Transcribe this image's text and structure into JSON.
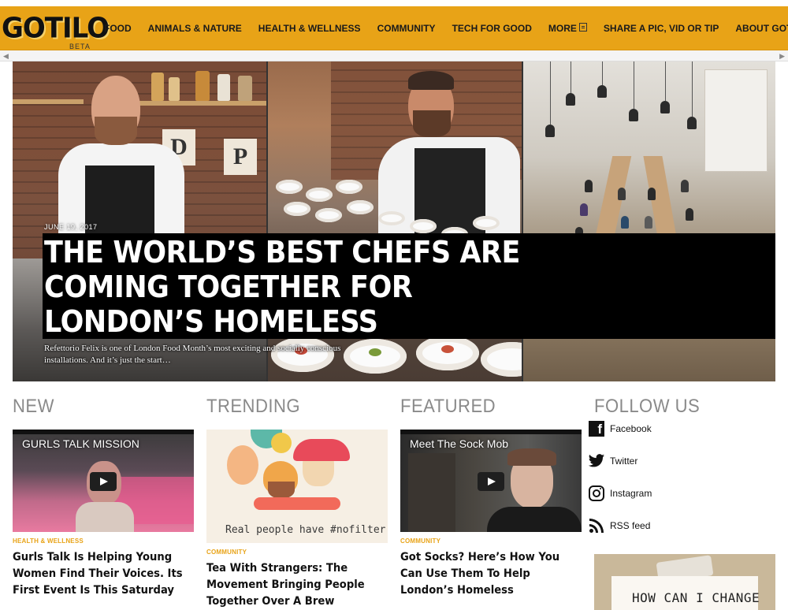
{
  "nav": {
    "logo": "GOTILO",
    "logo_beta": "BETA",
    "items": [
      {
        "label": "FOOD"
      },
      {
        "label": "ANIMALS & NATURE"
      },
      {
        "label": "HEALTH & WELLNESS"
      },
      {
        "label": "COMMUNITY"
      },
      {
        "label": "TECH FOR GOOD"
      },
      {
        "label": "MORE"
      },
      {
        "label": "SHARE A PIC, VID OR TIP"
      },
      {
        "label": "ABOUT GOTILO"
      }
    ],
    "more_icon": "list-icon"
  },
  "hero": {
    "date": "JUNE 19, 2017",
    "title": "THE WORLD’S BEST CHEFS ARE COMING TOGETHER FOR LONDON’S HOMELESS",
    "description": "Refettorio Felix is one of London Food Month’s most exciting and socially conscious installations. And it’s just the start…",
    "letter_cards": [
      "D",
      "P"
    ]
  },
  "sections": {
    "new": {
      "heading": "NEW",
      "video_title": "GURLS TALK MISSION",
      "category": "HEALTH & WELLNESS",
      "headline": "Gurls Talk Is Helping Young Women Find Their Voices. Its First Event Is This Saturday"
    },
    "trending": {
      "heading": "TRENDING",
      "image_caption": "Real people have #nofilter",
      "category": "COMMUNITY",
      "headline": "Tea With Strangers: The Movement Bringing People Together Over A Brew"
    },
    "featured": {
      "heading": "FEATURED",
      "video_title": "Meet The Sock Mob",
      "category": "COMMUNITY",
      "headline": "Got Socks? Here’s How You Can Use Them To Help London’s Homeless"
    },
    "follow": {
      "heading": "FOLLOW US",
      "links": [
        {
          "label": "Facebook",
          "icon": "facebook-icon"
        },
        {
          "label": "Twitter",
          "icon": "twitter-icon"
        },
        {
          "label": "Instagram",
          "icon": "instagram-icon"
        },
        {
          "label": "RSS feed",
          "icon": "rss-icon"
        }
      ],
      "promo_text": "HOW CAN I CHANGE"
    }
  },
  "colors": {
    "brand": "#e8a317",
    "heading_gray": "#8a8a8a",
    "hero_box": "#000000"
  }
}
